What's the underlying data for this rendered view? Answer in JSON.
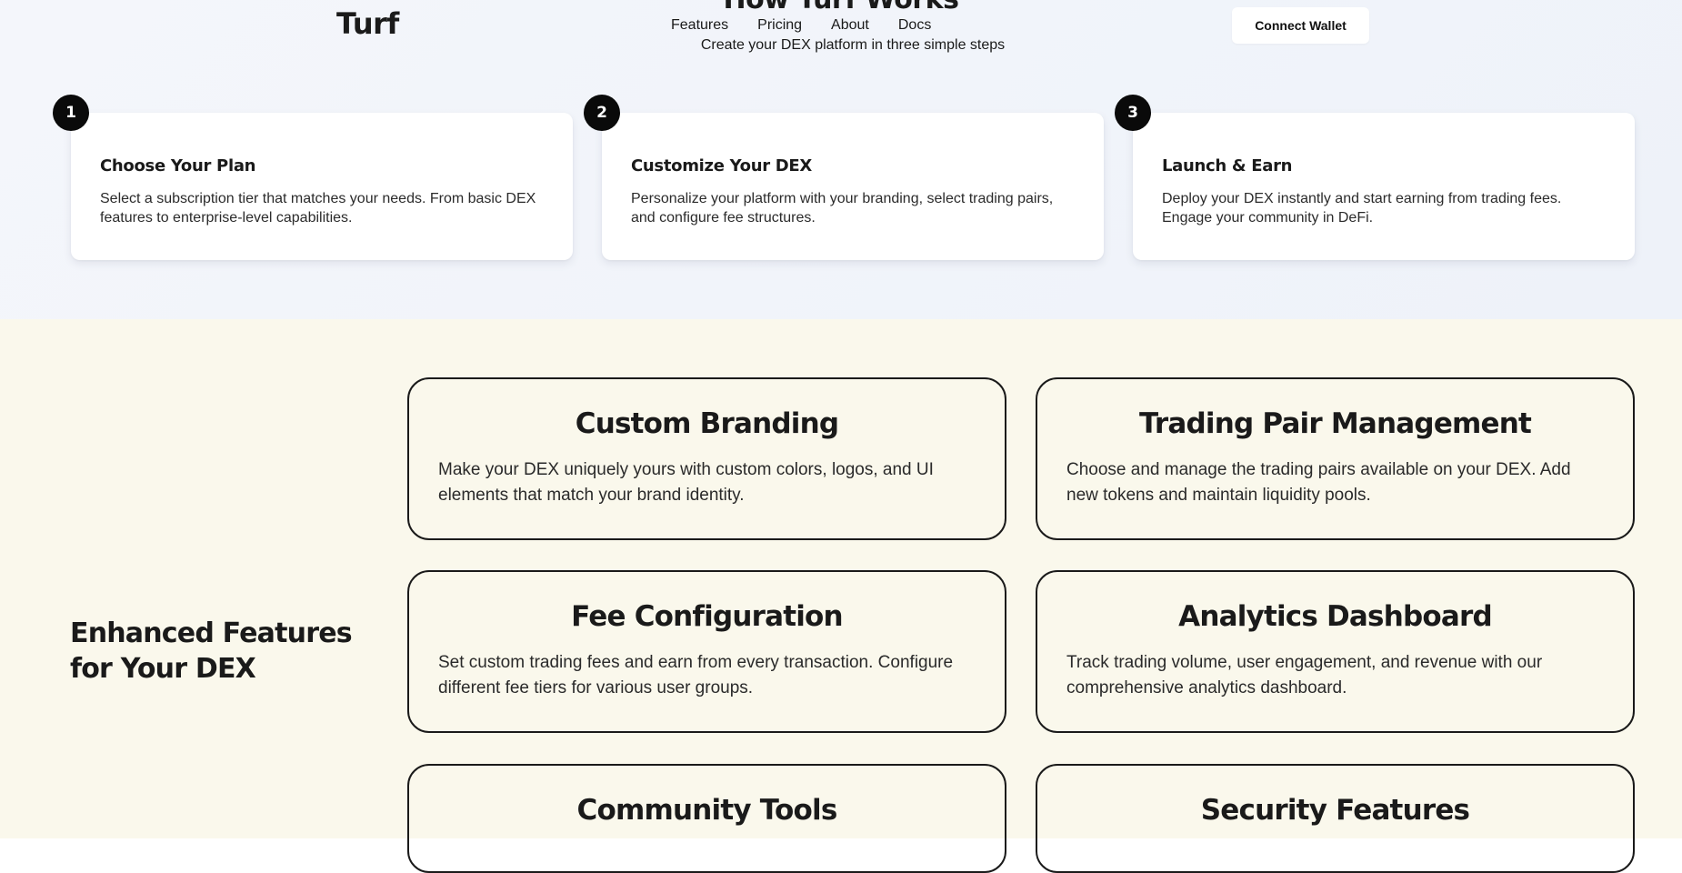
{
  "header": {
    "logo": "Turf",
    "section_title": "How Turf Works",
    "subtitle": "Create your DEX platform in three simple steps",
    "nav": [
      "Features",
      "Pricing",
      "About",
      "Docs"
    ],
    "connect_wallet": "Connect Wallet"
  },
  "steps": [
    {
      "number": "1",
      "title": "Choose Your Plan",
      "description": "Select a subscription tier that matches your needs. From basic DEX features to enterprise-level capabilities."
    },
    {
      "number": "2",
      "title": "Customize Your DEX",
      "description": "Personalize your platform with your branding, select trading pairs, and configure fee structures."
    },
    {
      "number": "3",
      "title": "Launch & Earn",
      "description": "Deploy your DEX instantly and start earning from trading fees. Engage your community in DeFi."
    }
  ],
  "features": {
    "heading": "Enhanced Features for Your DEX",
    "items": [
      {
        "title": "Custom Branding",
        "description": "Make your DEX uniquely yours with custom colors, logos, and UI elements that match your brand identity."
      },
      {
        "title": "Trading Pair Management",
        "description": "Choose and manage the trading pairs available on your DEX. Add new tokens and maintain liquidity pools."
      },
      {
        "title": "Fee Configuration",
        "description": "Set custom trading fees and earn from every transaction. Configure different fee tiers for various user groups."
      },
      {
        "title": "Analytics Dashboard",
        "description": "Track trading volume, user engagement, and revenue with our comprehensive analytics dashboard."
      },
      {
        "title": "Community Tools",
        "description": ""
      },
      {
        "title": "Security Features",
        "description": ""
      }
    ]
  }
}
